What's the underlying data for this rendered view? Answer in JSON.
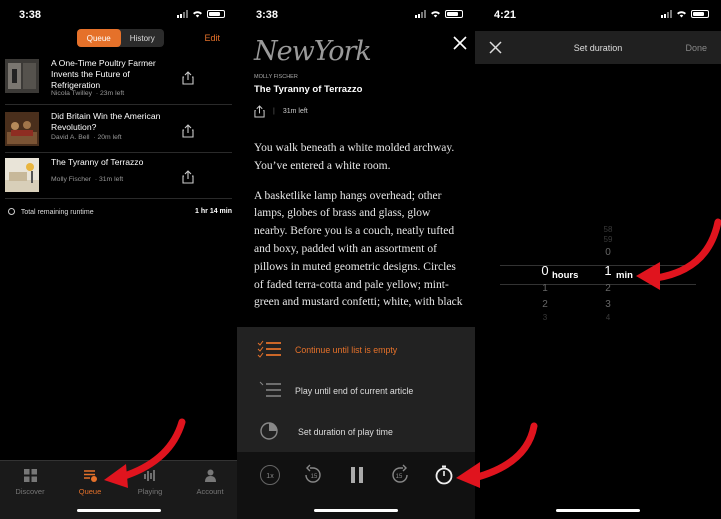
{
  "panel_queue": {
    "status_time": "3:38",
    "segment": {
      "queue": "Queue",
      "history": "History"
    },
    "edit": "Edit",
    "items": [
      {
        "title": "A One-Time Poultry Farmer Invents the Future of Refrigeration",
        "author": "Nicola Twilley",
        "remaining": "23m left"
      },
      {
        "title": "Did Britain Win the American Revolution?",
        "author": "David A. Bell",
        "remaining": "20m left"
      },
      {
        "title": "The Tyranny of Terrazzo",
        "author": "Molly Fischer",
        "remaining": "31m left"
      }
    ],
    "runtime_label": "Total remaining runtime",
    "runtime_value": "1 hr 14 min",
    "tabs": [
      {
        "label": "Discover",
        "icon": "grid-icon"
      },
      {
        "label": "Queue",
        "icon": "queue-icon"
      },
      {
        "label": "Playing",
        "icon": "waveform-icon"
      },
      {
        "label": "Account",
        "icon": "person-icon"
      }
    ]
  },
  "panel_article": {
    "status_time": "3:38",
    "logo": "NewYork",
    "author": "MOLLY FISCHER",
    "title": "The Tyranny of Terrazzo",
    "remaining": "31m left",
    "paragraphs": [
      "You walk beneath a white molded archway. You’ve entered a white room.",
      "A basketlike lamp hangs overhead; other lamps, globes of brass and glass, glow nearby. Before you is a couch, neatly tufted and boxy, padded with an assortment of pillows in muted geometric designs. Circles of faded terra-cotta and pale yellow; mint-green and mustard confetti; white, with black"
    ],
    "options": [
      {
        "label": "Continue until list is empty",
        "icon": "list-check-icon"
      },
      {
        "label": "Play until end of current article",
        "icon": "list-icon"
      },
      {
        "label": "Set duration of play time",
        "icon": "pie-timer-icon"
      }
    ],
    "speed": "1x",
    "skip_back": "15",
    "skip_fwd": "15"
  },
  "panel_duration": {
    "status_time": "4:21",
    "title": "Set duration",
    "done": "Done",
    "hours_label": "hours",
    "min_label": "min",
    "hours_col": {
      "above": [
        "",
        "",
        ""
      ],
      "selected": "0",
      "below": [
        "1",
        "2",
        "3"
      ]
    },
    "min_col": {
      "above": [
        "58",
        "59",
        "0"
      ],
      "selected": "1",
      "below": [
        "2",
        "3",
        "4"
      ]
    }
  },
  "colors": {
    "accent": "#e5712a",
    "annotation_arrow": "#e0141e"
  }
}
